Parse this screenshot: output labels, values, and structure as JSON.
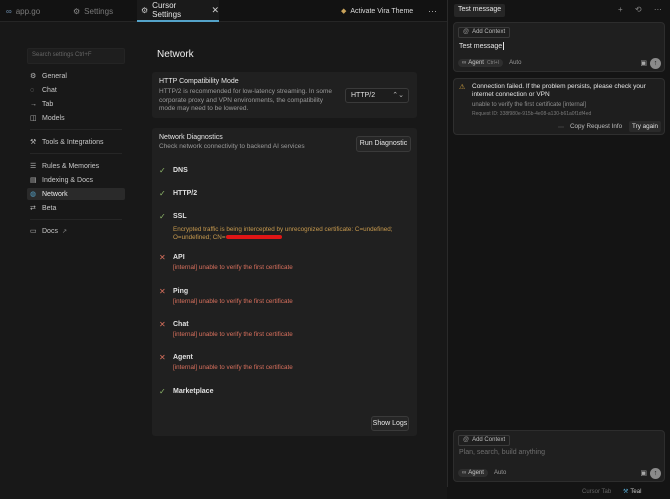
{
  "tabbar": {
    "tabs": [
      {
        "label": "app.go"
      },
      {
        "label": "Settings"
      },
      {
        "label": "Cursor Settings",
        "close": "✕"
      }
    ],
    "activate_theme": "Activate Vira Theme",
    "more": "⋯"
  },
  "settings": {
    "search_placeholder": "Search settings Ctrl+F",
    "nav": [
      {
        "label": "General",
        "icon": "gear-icon"
      },
      {
        "label": "Chat",
        "icon": "chat-icon"
      },
      {
        "label": "Tab",
        "icon": "tab-arrow-icon"
      },
      {
        "label": "Models",
        "icon": "cube-icon"
      },
      {
        "label": "Tools & Integrations",
        "icon": "tools-icon"
      },
      {
        "label": "Rules & Memories",
        "icon": "rules-icon"
      },
      {
        "label": "Indexing & Docs",
        "icon": "database-icon"
      },
      {
        "label": "Network",
        "icon": "globe-icon",
        "active": true
      },
      {
        "label": "Beta",
        "icon": "beta-icon"
      },
      {
        "label": "Docs",
        "icon": "book-icon"
      }
    ],
    "page_title": "Network",
    "http": {
      "title": "HTTP Compatibility Mode",
      "description": "HTTP/2 is recommended for low-latency streaming. In some corporate proxy and VPN environments, the compatibility mode may need to be lowered.",
      "selected": "HTTP/2"
    },
    "diagnostics": {
      "title": "Network Diagnostics",
      "description": "Check network connectivity to backend AI services",
      "run_button": "Run Diagnostic",
      "show_logs_button": "Show Logs",
      "items": [
        {
          "name": "DNS",
          "status": "ok",
          "detail": ""
        },
        {
          "name": "HTTP/2",
          "status": "ok",
          "detail": ""
        },
        {
          "name": "SSL",
          "status": "ok",
          "detail": "Encrypted traffic is being intercepted by unrecognized certificate: C=undefined; O=undefined; CN="
        },
        {
          "name": "API",
          "status": "fail",
          "detail": "[internal] unable to verify the first certificate"
        },
        {
          "name": "Ping",
          "status": "fail",
          "detail": "[internal] unable to verify the first certificate"
        },
        {
          "name": "Chat",
          "status": "fail",
          "detail": "[internal] unable to verify the first certificate"
        },
        {
          "name": "Agent",
          "status": "fail",
          "detail": "[internal] unable to verify the first certificate"
        },
        {
          "name": "Marketplace",
          "status": "ok",
          "detail": ""
        }
      ]
    }
  },
  "chat": {
    "tab_title": "Test message",
    "header_icons": "+ ⟲ ⋯",
    "add_context": "Add Context",
    "message": "Test message",
    "agent_label": "Agent",
    "agent_shortcut": "Ctrl+I",
    "auto_label": "Auto",
    "error": {
      "title": "Connection failed. If the problem persists, please check your internet connection or VPN",
      "detail": "unable to verify the first certificate [internal]",
      "request_id": "Request ID: 338f980e-915b-4e08-a130-b61a0f1df4ed",
      "copy_request": "Copy Request Info",
      "try_again": "Try again",
      "more": "⋯"
    },
    "composer_placeholder": "Plan, search, build anything"
  },
  "statusbar": {
    "tab_label": "Cursor Tab",
    "theme": "Teal"
  },
  "colors": {
    "accent": "#54a3c9",
    "ok": "#8fb86a",
    "fail": "#d9705d",
    "warn": "#c89a4e"
  }
}
